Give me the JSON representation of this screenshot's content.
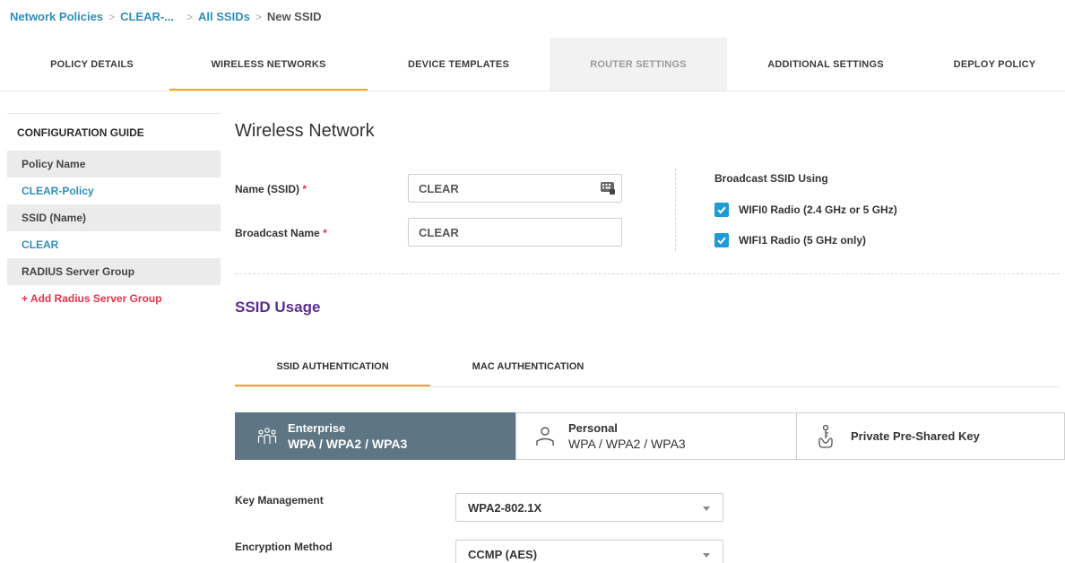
{
  "breadcrumb": {
    "items": [
      "Network Policies",
      "CLEAR-...",
      "All SSIDs",
      "New SSID"
    ],
    "separator": ">"
  },
  "tabs": [
    {
      "label": "POLICY DETAILS",
      "state": "normal"
    },
    {
      "label": "WIRELESS NETWORKS",
      "state": "active"
    },
    {
      "label": "DEVICE TEMPLATES",
      "state": "normal"
    },
    {
      "label": "ROUTER SETTINGS",
      "state": "disabled"
    },
    {
      "label": "ADDITIONAL SETTINGS",
      "state": "normal"
    },
    {
      "label": "DEPLOY POLICY",
      "state": "normal"
    }
  ],
  "guide": {
    "title": "CONFIGURATION GUIDE",
    "policy_label": "Policy Name",
    "policy_value": "CLEAR-Policy",
    "ssid_label": "SSID (Name)",
    "ssid_value": "CLEAR",
    "radius_label": "RADIUS Server Group",
    "radius_add": "+ Add Radius Server Group"
  },
  "form": {
    "title": "Wireless Network",
    "name_label": "Name (SSID)",
    "name_value": "CLEAR",
    "broadcast_label": "Broadcast Name",
    "broadcast_value": "CLEAR",
    "required_mark": "*",
    "broadcast_using_title": "Broadcast SSID Using",
    "radio0_label": "WIFI0 Radio (2.4 GHz or 5 GHz)",
    "radio0_checked": true,
    "radio1_label": "WIFI1 Radio (5 GHz only)",
    "radio1_checked": true
  },
  "usage": {
    "title": "SSID Usage",
    "subtabs": [
      "SSID AUTHENTICATION",
      "MAC AUTHENTICATION"
    ],
    "active_subtab": "SSID AUTHENTICATION",
    "cards": {
      "enterprise_title": "Enterprise",
      "enterprise_sub": "WPA / WPA2 / WPA3",
      "personal_title": "Personal",
      "personal_sub": "WPA / WPA2 / WPA3",
      "ppsk_title": "Private Pre-Shared Key"
    },
    "selected_card": "Enterprise",
    "key_mgmt_label": "Key Management",
    "key_mgmt_value": "WPA2-802.1X",
    "encryption_label": "Encryption Method",
    "encryption_value": "CCMP (AES)"
  },
  "icons": {
    "enterprise": "users-group-icon",
    "personal": "user-icon",
    "ppsk": "key-hand-icon",
    "name_input": "keyboard-icon",
    "checkbox": "checkmark-icon",
    "dropdown": "chevron-down-icon"
  },
  "colors": {
    "link": "#2f8fb8",
    "accent_tab": "#f5a623",
    "required": "#e8334a",
    "usage_title": "#5b2d91",
    "selected_card": "#5e7583",
    "checkbox": "#1e9ad6"
  }
}
